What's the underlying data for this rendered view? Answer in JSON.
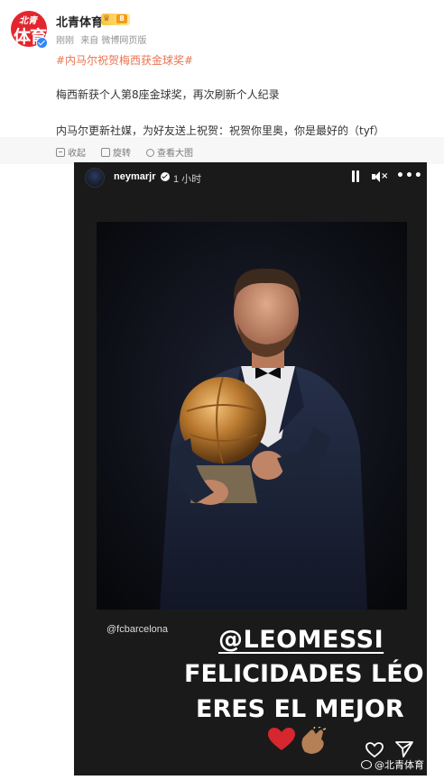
{
  "post": {
    "account_name": "北青体育",
    "avatar_text_top": "北青",
    "avatar_text_main": "体育",
    "vip_level": "8",
    "time": "刚刚",
    "source": "来自 微博网页版",
    "hashtag": "#内马尔祝贺梅西获金球奖#",
    "line1": "梅西新获个人第8座金球奖，再次刷新个人纪录",
    "line2": "内马尔更新社媒，为好友送上祝贺：祝贺你里奥，你是最好的（tyf）"
  },
  "actions": {
    "collapse": "收起",
    "repost": "旋转",
    "enlarge": "查看大图"
  },
  "story": {
    "username": "neymarjr",
    "time": "1 小时",
    "handle": "@fcbarcelona",
    "mention": "@LEOMESSI",
    "caption_line1": "FELICIDADES LÉO",
    "caption_line2": "ERES EL MEJOR"
  },
  "watermark": "@北青体育",
  "colors": {
    "hashtag": "#eb7350",
    "brand_red": "#e3262d",
    "story_bg": "#1a1a1b"
  }
}
